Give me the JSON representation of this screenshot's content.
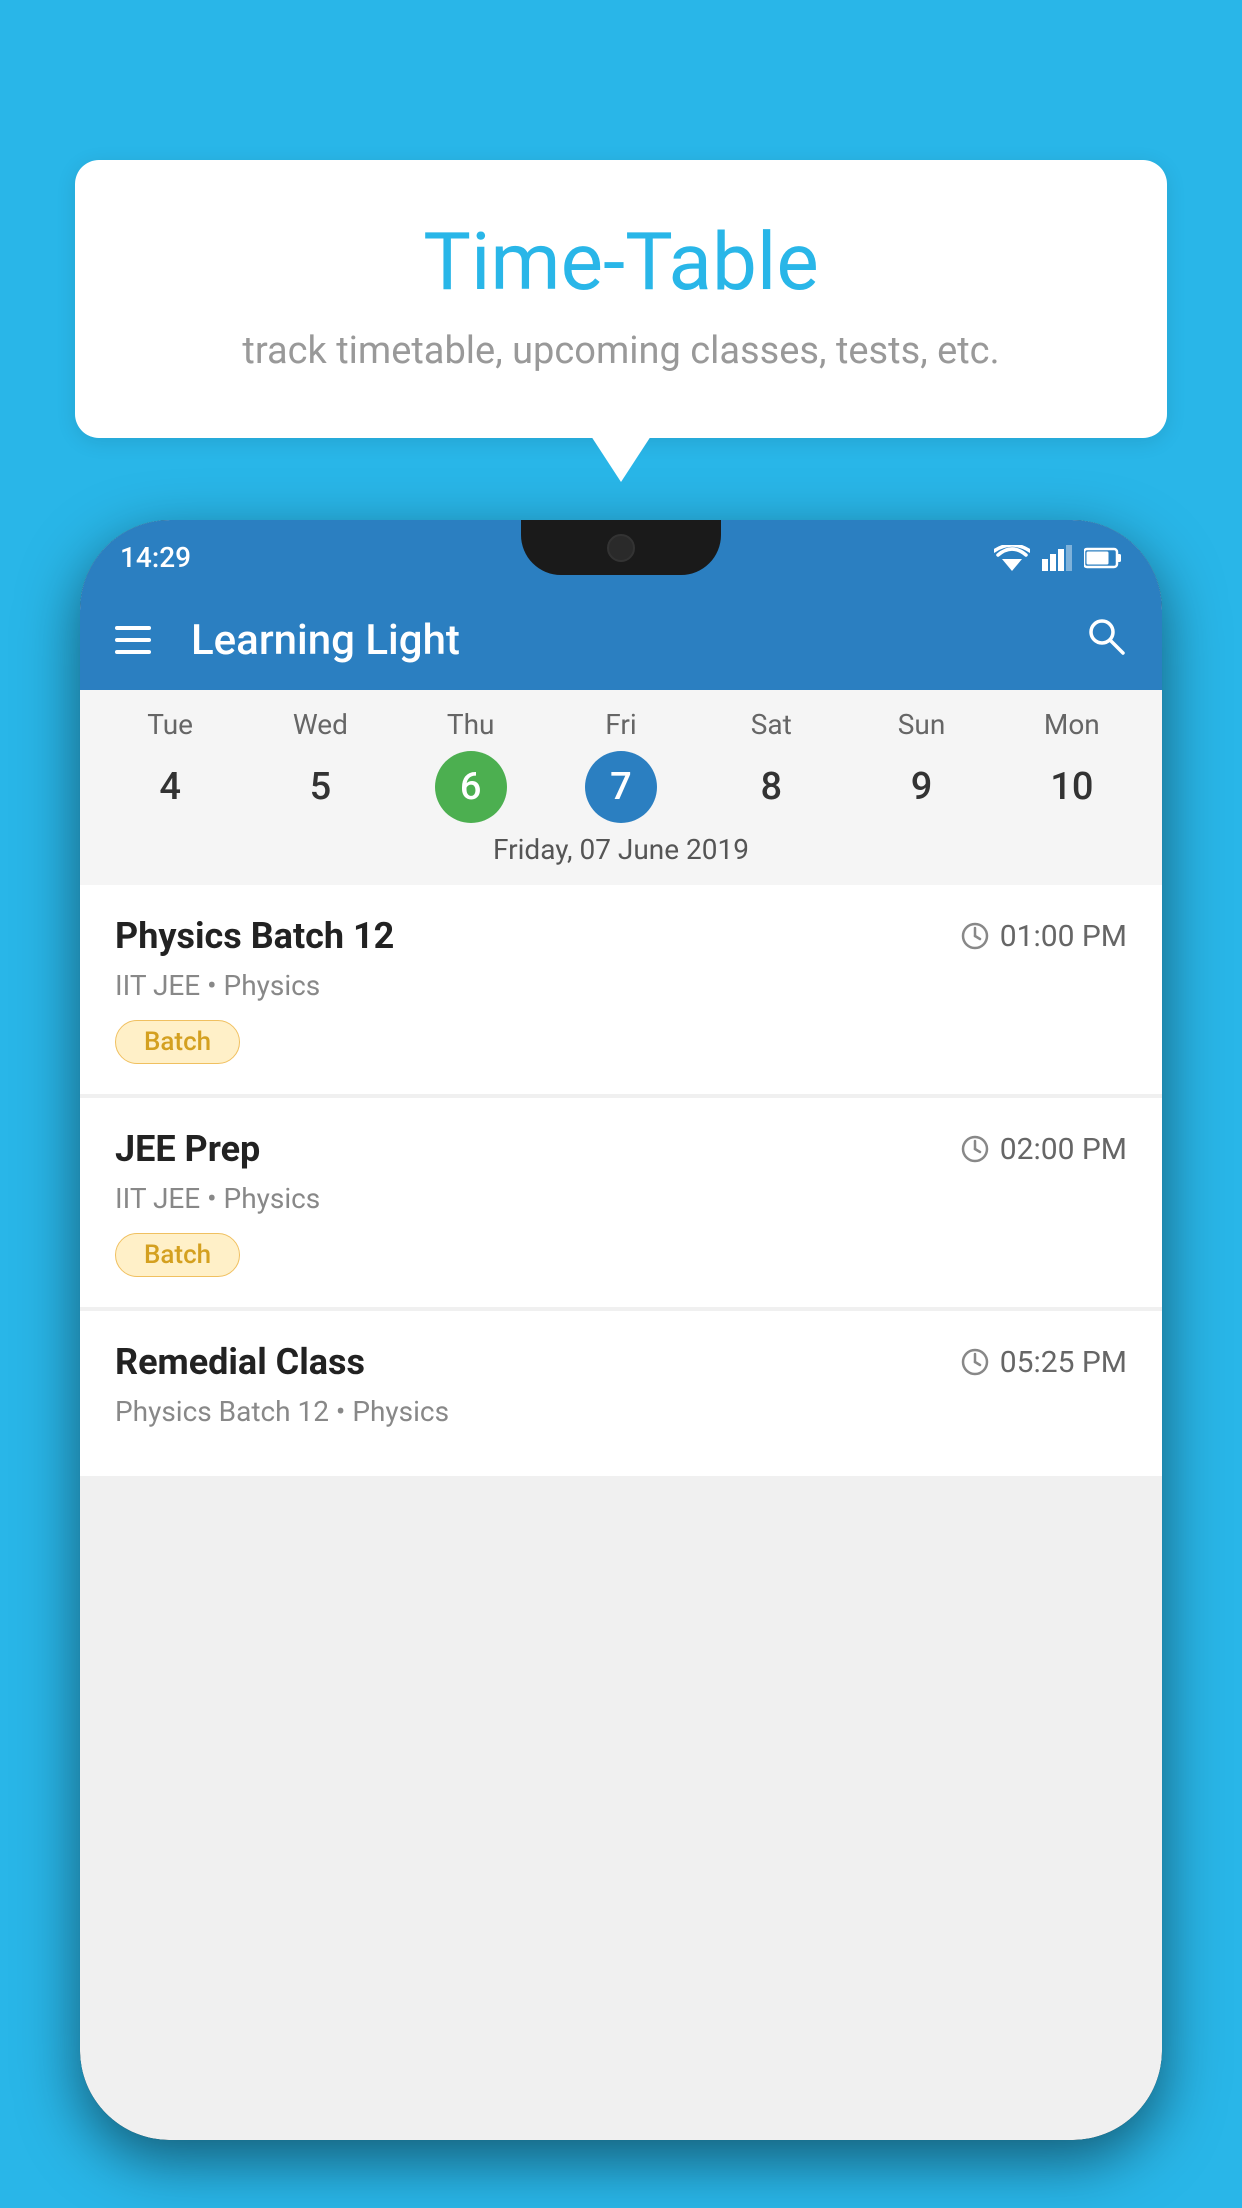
{
  "background": {
    "color": "#29B6E8"
  },
  "tooltip": {
    "title": "Time-Table",
    "subtitle": "track timetable, upcoming classes, tests, etc."
  },
  "phone": {
    "statusBar": {
      "time": "14:29"
    },
    "appBar": {
      "title": "Learning Light"
    },
    "calendar": {
      "days": [
        {
          "name": "Tue",
          "number": "4",
          "state": "normal"
        },
        {
          "name": "Wed",
          "number": "5",
          "state": "normal"
        },
        {
          "name": "Thu",
          "number": "6",
          "state": "today"
        },
        {
          "name": "Fri",
          "number": "7",
          "state": "selected"
        },
        {
          "name": "Sat",
          "number": "8",
          "state": "normal"
        },
        {
          "name": "Sun",
          "number": "9",
          "state": "normal"
        },
        {
          "name": "Mon",
          "number": "10",
          "state": "normal"
        }
      ],
      "selectedDate": "Friday, 07 June 2019"
    },
    "events": [
      {
        "title": "Physics Batch 12",
        "time": "01:00 PM",
        "subtitle": "IIT JEE • Physics",
        "badge": "Batch"
      },
      {
        "title": "JEE Prep",
        "time": "02:00 PM",
        "subtitle": "IIT JEE • Physics",
        "badge": "Batch"
      },
      {
        "title": "Remedial Class",
        "time": "05:25 PM",
        "subtitle": "Physics Batch 12 • Physics",
        "badge": null
      }
    ]
  }
}
